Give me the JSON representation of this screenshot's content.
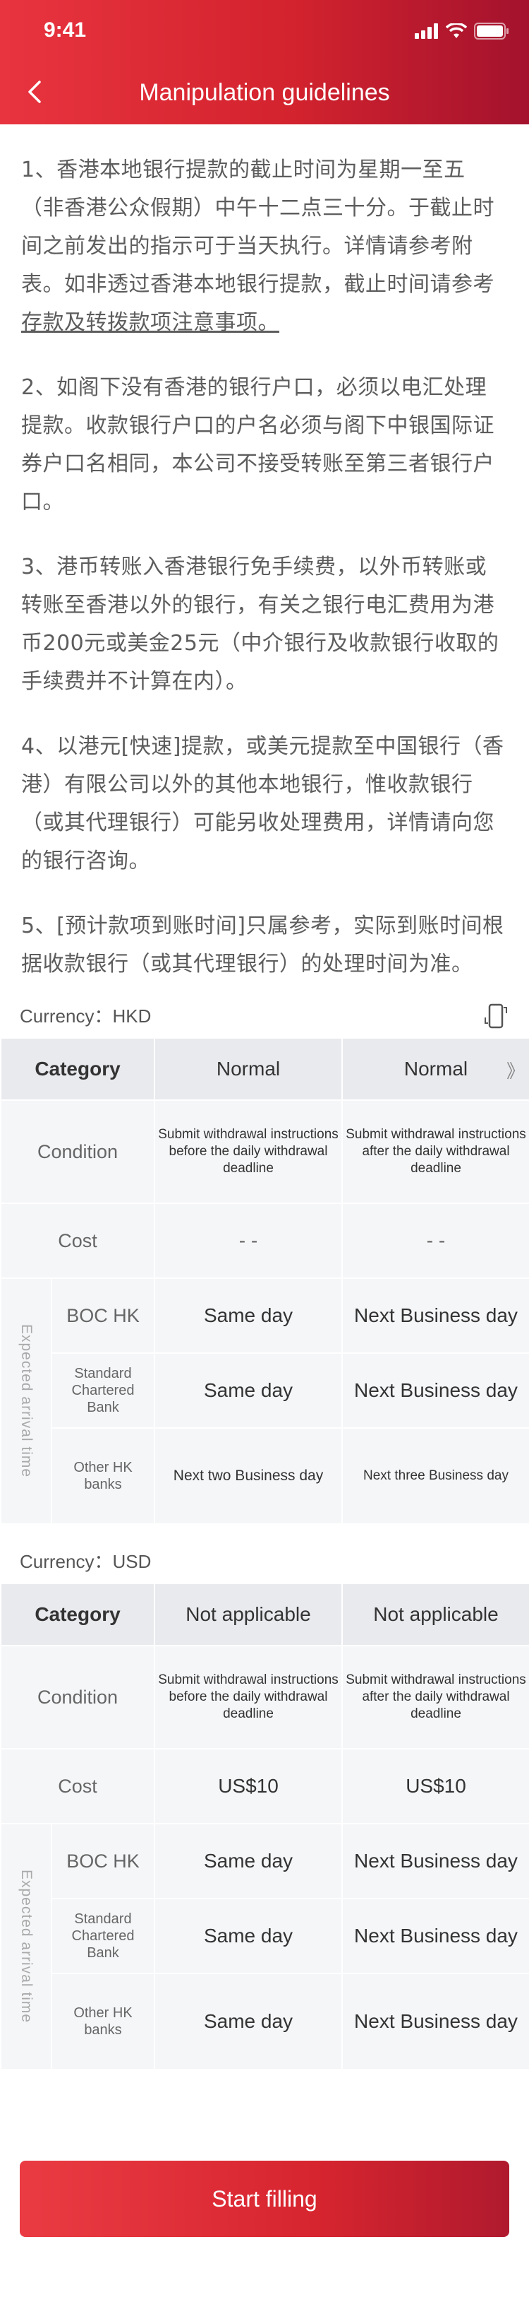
{
  "status_bar": {
    "time": "9:41"
  },
  "header": {
    "title": "Manipulation guidelines"
  },
  "paragraphs": [
    "1、香港本地银行提款的截止时间为星期一至五（非香港公众假期）中午十二点三十分。于截止时间之前发出的指示可于当天执行。详情请参考附表。如非透过香港本地银行提款，截止时间请参考",
    "2、如阁下没有香港的银行户口，必须以电汇处理提款。收款银行户口的户名必须与阁下中银国际证券户口名相同，本公司不接受转账至第三者银行户口。",
    "3、港币转账入香港银行免手续费，以外币转账或转账至香港以外的银行，有关之银行电汇费用为港币200元或美金25元（中介银行及收款银行收取的手续费并不计算在内）。",
    "4、以港元[快速]提款，或美元提款至中国银行（香港）有限公司以外的其他本地银行，惟收款银行（或其代理银行）可能另收处理费用，详情请向您的银行咨询。",
    "5、[预计款项到账时间]只属参考，实际到账时间根据收款银行（或其代理银行）的处理时间为准。"
  ],
  "para1_link": "存款及转拨款项注意事项。",
  "tables": {
    "hkd": {
      "currency_label": "Currency：HKD",
      "header": [
        "Category",
        "Normal",
        "Normal"
      ],
      "condition_label": "Condition",
      "condition": [
        "Submit withdrawal instructions before the daily withdrawal deadline",
        "Submit withdrawal instructions after the daily withdrawal deadline"
      ],
      "cost_label": "Cost",
      "cost": [
        "- -",
        "- -"
      ],
      "expected_label": "Expected arrival time",
      "rows": [
        {
          "bank": "BOC HK",
          "values": [
            "Same day",
            "Next Business day"
          ]
        },
        {
          "bank": "Standard Chartered Bank",
          "values": [
            "Same day",
            "Next Business day"
          ]
        },
        {
          "bank": "Other HK banks",
          "values": [
            "Next two Business day",
            "Next three Business day"
          ]
        }
      ]
    },
    "usd": {
      "currency_label": "Currency：USD",
      "header": [
        "Category",
        "Not applicable",
        "Not applicable"
      ],
      "condition_label": "Condition",
      "condition": [
        "Submit withdrawal instructions before the daily withdrawal deadline",
        "Submit withdrawal instructions after the daily withdrawal deadline"
      ],
      "cost_label": "Cost",
      "cost": [
        "US$10",
        "US$10"
      ],
      "expected_label": "Expected arrival time",
      "rows": [
        {
          "bank": "BOC HK",
          "values": [
            "Same day",
            "Next Business day"
          ]
        },
        {
          "bank": "Standard Chartered Bank",
          "values": [
            "Same day",
            "Next Business day"
          ]
        },
        {
          "bank": "Other HK banks",
          "values": [
            "Same day",
            "Next Business day"
          ]
        }
      ]
    }
  },
  "scroll_hint": "》",
  "footer": {
    "button_label": "Start filling"
  },
  "icons": {
    "back": "chevron-left-icon",
    "signal": "signal-icon",
    "wifi": "wifi-icon",
    "battery": "battery-icon",
    "phone": "phone-rotate-icon"
  },
  "colors": {
    "primary": "#e8343f",
    "primary_dark": "#a3122d"
  }
}
